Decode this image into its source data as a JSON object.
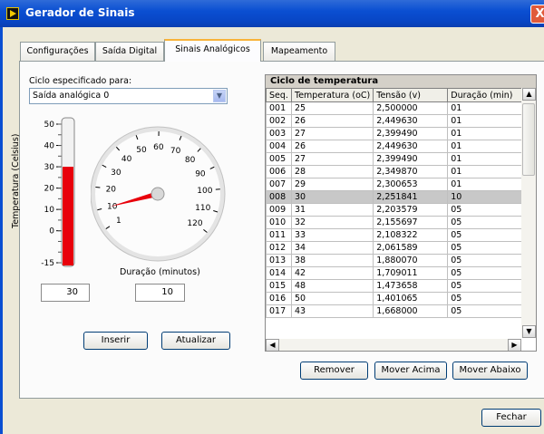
{
  "window": {
    "title": "Gerador de Sinais",
    "close": "X"
  },
  "tabs": [
    "Configurações",
    "Saída Digital",
    "Sinais Analógicos",
    "Mapeamento"
  ],
  "active_tab": 2,
  "cycle": {
    "label": "Ciclo especificado para:",
    "selected": "Saída analógica 0"
  },
  "thermometer": {
    "axis_label": "Temperatura (Celsius)",
    "ticks": [
      "50",
      "40",
      "30",
      "20",
      "10",
      "0",
      "-15"
    ],
    "min": -15,
    "max": 50,
    "value": 30,
    "fill_color": "#e8000b",
    "display_value": "30"
  },
  "gauge": {
    "ticks": [
      "1",
      "10",
      "20",
      "30",
      "40",
      "50",
      "60",
      "70",
      "80",
      "90",
      "100",
      "110",
      "120"
    ],
    "min": 1,
    "max": 120,
    "value": 10,
    "needle_color": "#e8000b",
    "label": "Duração (minutos)",
    "display_value": "10"
  },
  "buttons": {
    "inserir": "Inserir",
    "atualizar": "Atualizar",
    "remover": "Remover",
    "mover_acima": "Mover Acima",
    "mover_abaixo": "Mover Abaixo",
    "fechar": "Fechar"
  },
  "table": {
    "caption": "Ciclo de temperatura",
    "headers": [
      "Seq.",
      "Temperatura (oC)",
      "Tensão (v)",
      "Duração (min)"
    ],
    "selected_row": 7,
    "rows": [
      [
        "001",
        "25",
        "2,500000",
        "01"
      ],
      [
        "002",
        "26",
        "2,449630",
        "01"
      ],
      [
        "003",
        "27",
        "2,399490",
        "01"
      ],
      [
        "004",
        "26",
        "2,449630",
        "01"
      ],
      [
        "005",
        "27",
        "2,399490",
        "01"
      ],
      [
        "006",
        "28",
        "2,349870",
        "01"
      ],
      [
        "007",
        "29",
        "2,300653",
        "01"
      ],
      [
        "008",
        "30",
        "2,251841",
        "10"
      ],
      [
        "009",
        "31",
        "2,203579",
        "05"
      ],
      [
        "010",
        "32",
        "2,155697",
        "05"
      ],
      [
        "011",
        "33",
        "2,108322",
        "05"
      ],
      [
        "012",
        "34",
        "2,061589",
        "05"
      ],
      [
        "013",
        "38",
        "1,880070",
        "05"
      ],
      [
        "014",
        "42",
        "1,709011",
        "05"
      ],
      [
        "015",
        "48",
        "1,473658",
        "05"
      ],
      [
        "016",
        "50",
        "1,401065",
        "05"
      ],
      [
        "017",
        "43",
        "1,668000",
        "05"
      ]
    ]
  }
}
